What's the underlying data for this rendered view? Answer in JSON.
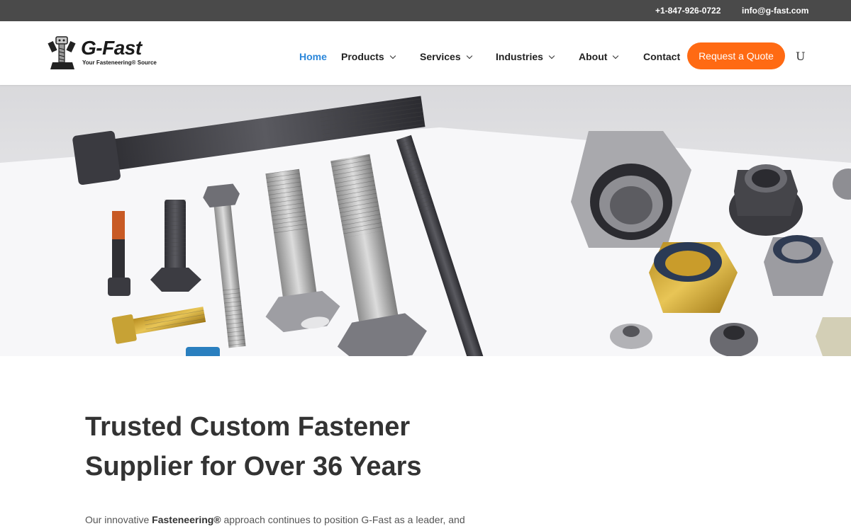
{
  "topbar": {
    "phone": "+1-847-926-0722",
    "email": "info@g-fast.com"
  },
  "logo": {
    "name": "G-Fast",
    "tagline": "Your Fasteneering® Source"
  },
  "nav": {
    "home": "Home",
    "products": "Products",
    "services": "Services",
    "industries": "Industries",
    "about": "About",
    "contact": "Contact",
    "quote_button": "Request a Quote",
    "search_glyph": "U"
  },
  "hero": {
    "image": "hero-fasteners-photo",
    "subject": "bolts and nuts"
  },
  "content": {
    "headline_line1": "Trusted Custom Fastener",
    "headline_line2": "Supplier for Over 36 Years",
    "intro_before": "Our innovative ",
    "intro_bold": "Fasteneering®",
    "intro_after": " approach continues to position G-Fast as a leader, and"
  },
  "colors": {
    "topbar_bg": "#4a4a4a",
    "active_link": "#2b87da",
    "cta": "#ff6a13",
    "headline": "#333333"
  },
  "icons": [
    "chevron-down-icon",
    "search-icon",
    "logo-bolt-mascot-icon"
  ]
}
